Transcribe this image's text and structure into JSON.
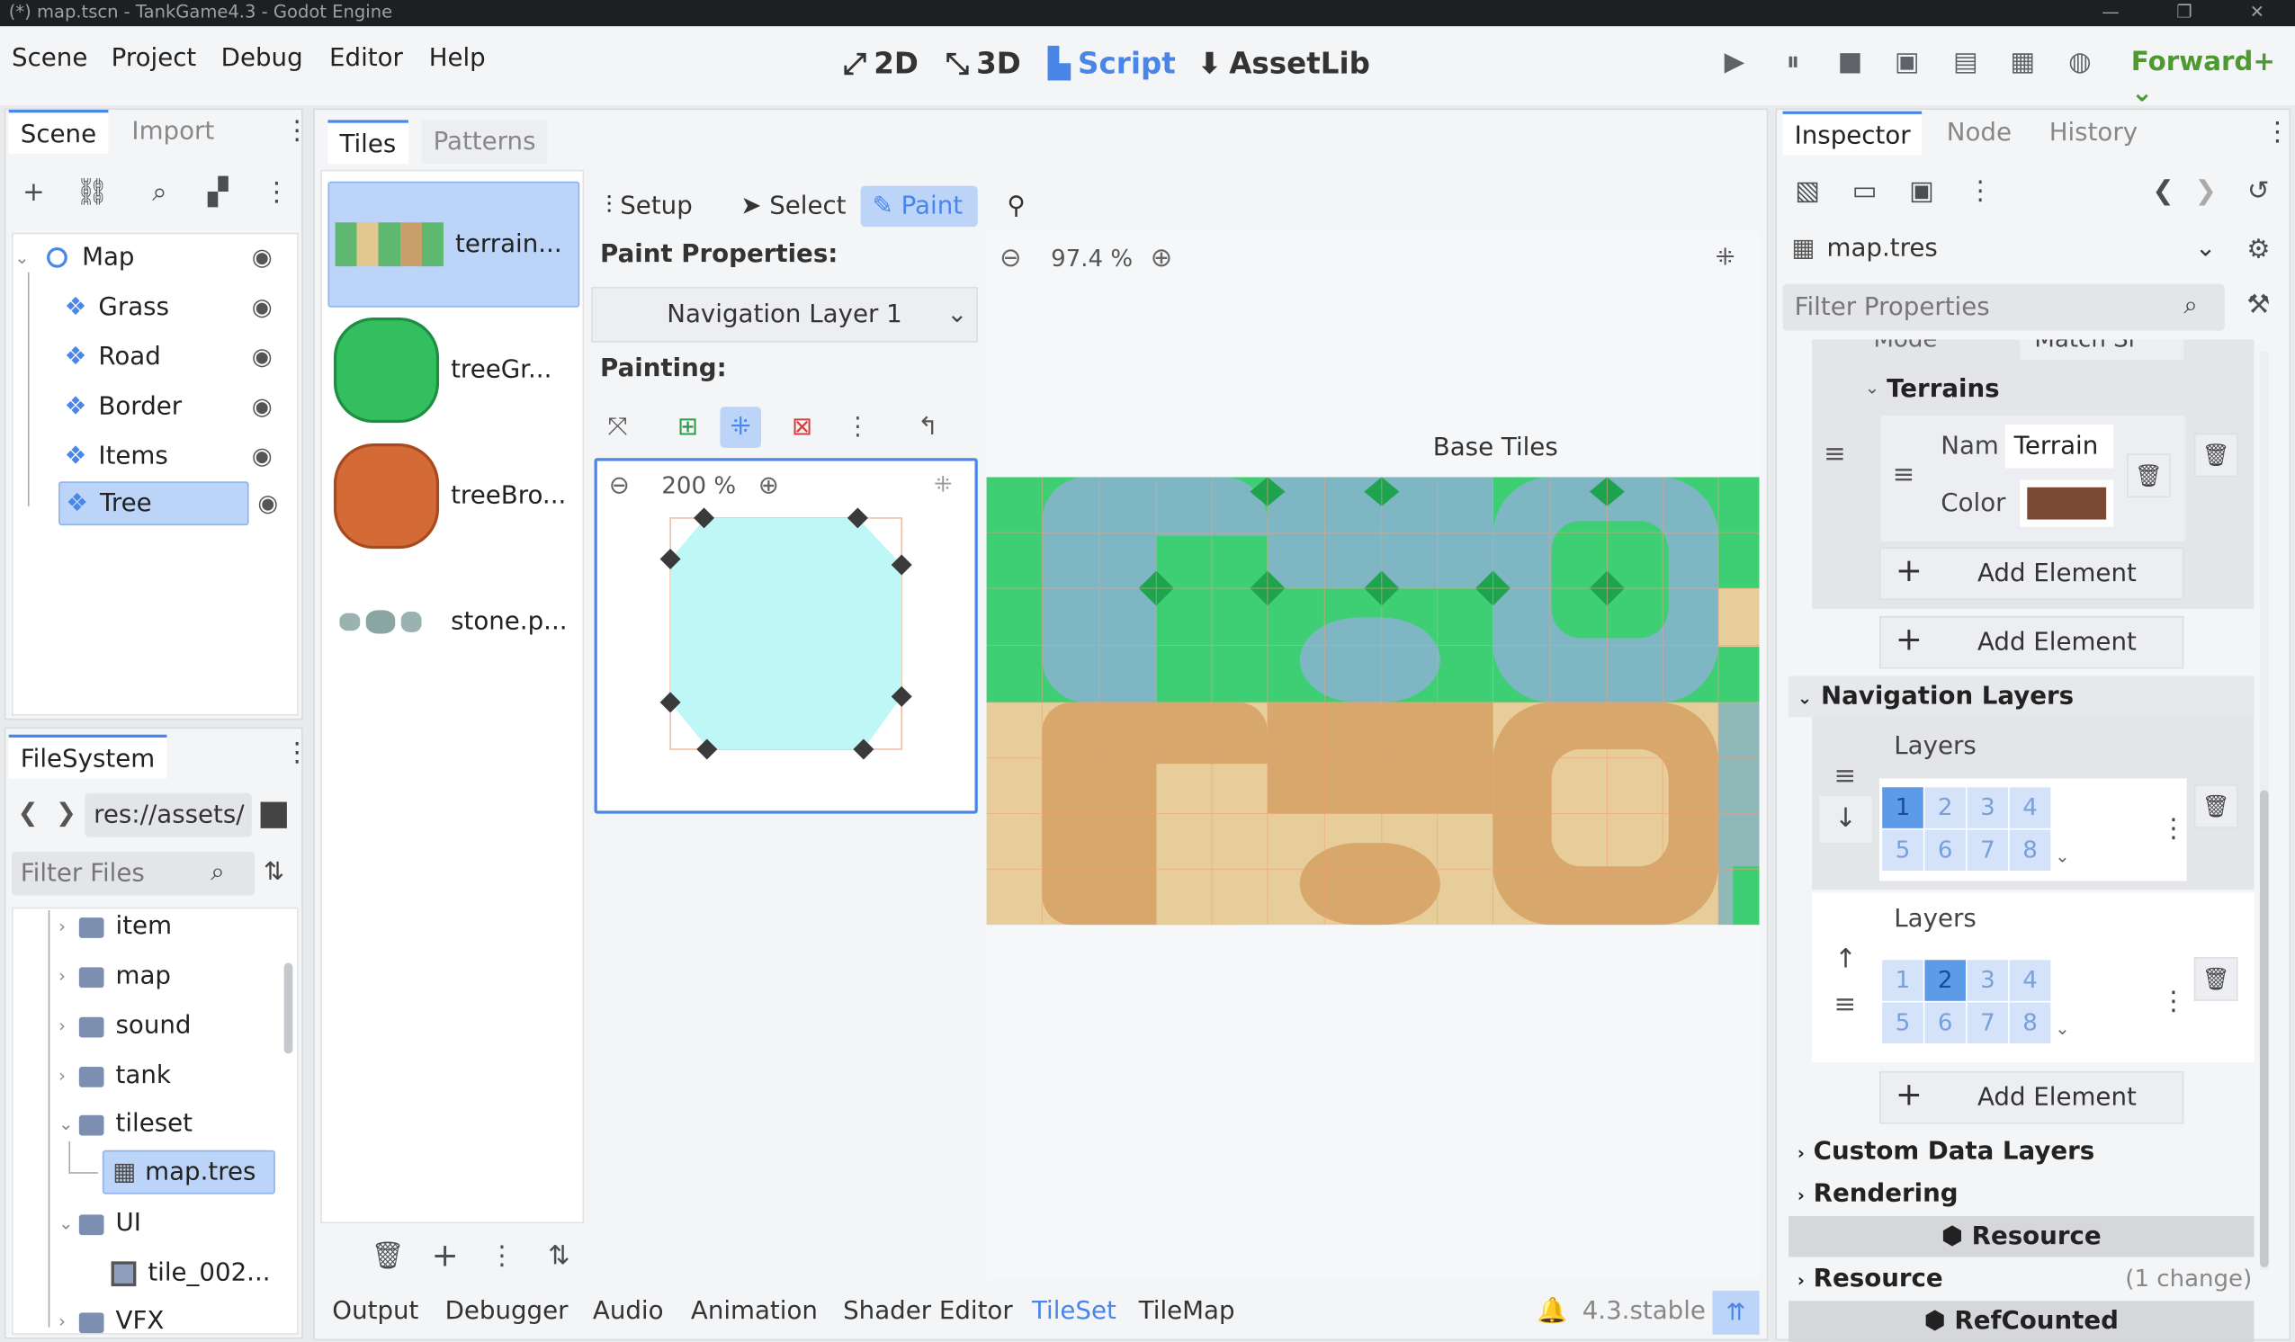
{
  "window": {
    "title": "(*) map.tscn - TankGame4.3 - Godot Engine"
  },
  "menu": [
    "Scene",
    "Project",
    "Debug",
    "Editor",
    "Help"
  ],
  "workspaces": [
    {
      "label": "2D",
      "icon": "2d-icon"
    },
    {
      "label": "3D",
      "icon": "3d-icon"
    },
    {
      "label": "Script",
      "icon": "script-icon",
      "active": true
    },
    {
      "label": "AssetLib",
      "icon": "assetlib-icon"
    }
  ],
  "renderer": "Forward+",
  "scene_dock": {
    "tabs": [
      "Scene",
      "Import"
    ],
    "tree": [
      {
        "label": "Map",
        "level": 0
      },
      {
        "label": "Grass",
        "level": 1
      },
      {
        "label": "Road",
        "level": 1
      },
      {
        "label": "Border",
        "level": 1
      },
      {
        "label": "Items",
        "level": 1
      },
      {
        "label": "Tree",
        "level": 1,
        "selected": true
      }
    ]
  },
  "filesystem": {
    "tab": "FileSystem",
    "path": "res://assets/",
    "filter_placeholder": "Filter Files",
    "items": [
      "item",
      "map",
      "sound",
      "tank",
      "tileset",
      "map.tres",
      "UI",
      "tile_002...",
      "VFX"
    ]
  },
  "tiles_panel": {
    "tabs": [
      "Tiles",
      "Patterns"
    ],
    "sources": [
      "terrain...",
      "treeGr...",
      "treeBro...",
      "stone.p..."
    ]
  },
  "paint": {
    "tools": [
      "Setup",
      "Select",
      "Paint"
    ],
    "properties_label": "Paint Properties:",
    "dropdown": "Navigation Layer 1",
    "painting_label": "Painting:",
    "zoom": "200 %"
  },
  "viewport": {
    "zoom": "97.4 %",
    "label": "Base Tiles"
  },
  "bottom_tabs": [
    "Output",
    "Debugger",
    "Audio",
    "Animation",
    "Shader Editor",
    "TileSet",
    "TileMap"
  ],
  "version": "4.3.stable",
  "inspector": {
    "tabs": [
      "Inspector",
      "Node",
      "History"
    ],
    "resource": "map.tres",
    "filter_placeholder": "Filter Properties",
    "clipped_row": {
      "label": "Mode",
      "value": "Match Si"
    },
    "terrains_label": "Terrains",
    "name_label": "Nam",
    "name_value": "Terrain",
    "color_label": "Color",
    "terrain_color": "#7a4a33",
    "add_element": "Add Element",
    "nav_layers": "Navigation Layers",
    "layers_label": "Layers",
    "layer_numbers": [
      "1",
      "2",
      "3",
      "4",
      "5",
      "6",
      "7",
      "8"
    ],
    "custom_data": "Custom Data Layers",
    "rendering": "Rendering",
    "resource_section": "Resource",
    "resource_row": "Resource",
    "changes": "(1 change)",
    "refcounted": "RefCounted"
  }
}
